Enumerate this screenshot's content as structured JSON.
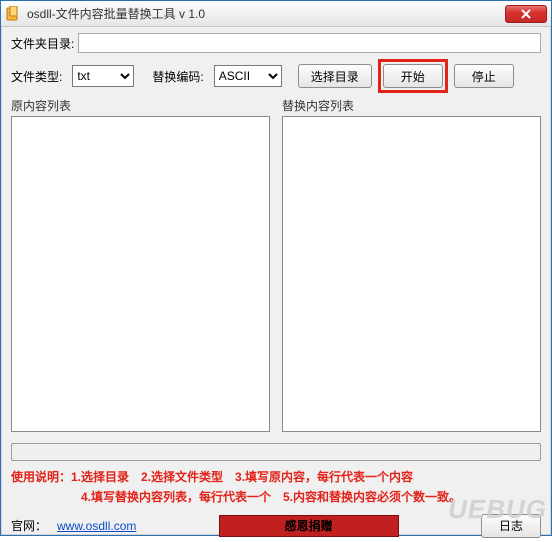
{
  "window": {
    "title": "osdll-文件内容批量替换工具 v 1.0"
  },
  "labels": {
    "folder_dir": "文件夹目录:",
    "file_type": "文件类型:",
    "encoding": "替换编码:",
    "orig_list": "原内容列表",
    "replace_list": "替换内容列表",
    "website_prefix": "官网："
  },
  "inputs": {
    "folder_dir_value": "",
    "file_type_value": "txt",
    "encoding_value": "ASCII",
    "orig_text": "",
    "replace_text": ""
  },
  "buttons": {
    "choose_dir": "选择目录",
    "start": "开始",
    "stop": "停止",
    "donate": "感恩捐赠",
    "log": "日志"
  },
  "instructions": {
    "line1": "使用说明：1.选择目录　2.选择文件类型　3.填写原内容，每行代表一个内容",
    "line2": "4.填写替换内容列表，每行代表一个　5.内容和替换内容必须个数一致。"
  },
  "website": {
    "url_text": "www.osdll.com"
  },
  "watermark": "UEBUG"
}
